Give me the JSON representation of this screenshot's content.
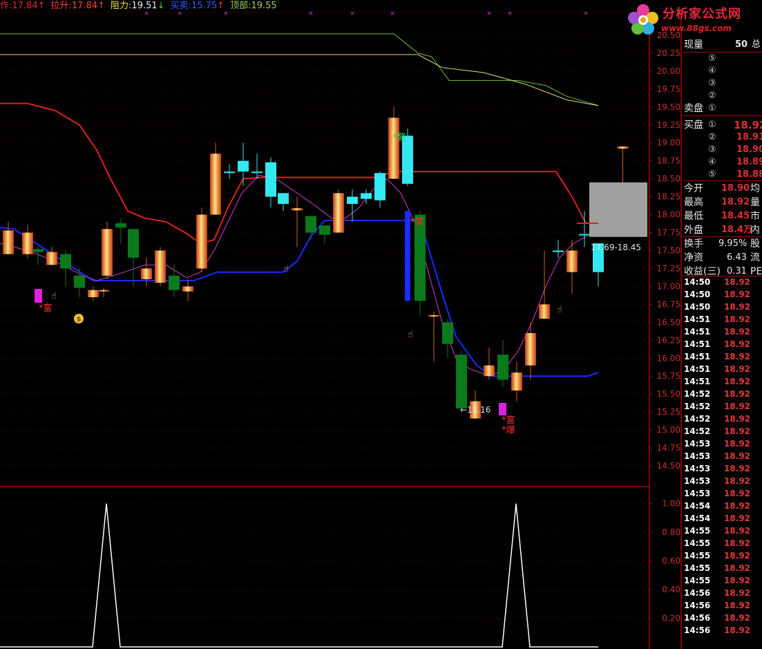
{
  "indicator_bar": [
    {
      "label": "作: ",
      "value": "17.84",
      "arrow": "↑",
      "label_color": "#e03030",
      "value_color": "#e03030",
      "arrow_color": "#e03030"
    },
    {
      "label": "拉升: ",
      "value": "17.84",
      "arrow": "↑",
      "label_color": "#ff4040",
      "value_color": "#ff4040",
      "arrow_color": "#ff4040"
    },
    {
      "label": "阻力: ",
      "value": "19.51",
      "arrow": "↓",
      "label_color": "#f0e040",
      "value_color": "#f0f0f0",
      "arrow_color": "#40d040"
    },
    {
      "label": "买卖: ",
      "value": "15.75",
      "arrow": "↑",
      "label_color": "#3060ff",
      "value_color": "#3060ff",
      "arrow_color": "#ff3030"
    },
    {
      "label": "顶部: ",
      "value": "19.55",
      "arrow": "",
      "label_color": "#a0d060",
      "value_color": "#a0d060",
      "arrow_color": "#a0d060"
    }
  ],
  "logo": {
    "name": "分析家公式网",
    "url": "www.88gs.com"
  },
  "colors": {
    "background": "#000000",
    "grid": "#5a0000",
    "axis": "#b00000",
    "tick_text": "#c83030",
    "cyan": "#33e8f0",
    "green_candle": "#0a7a1a",
    "red_line": "#e02020",
    "blue_line": "#1a2cff",
    "magenta_line": "#d040d0",
    "yellow_line": "#e0e080",
    "green_line": "#70c040"
  },
  "chart_data": [
    {
      "type": "candlestick",
      "ylim": [
        14.25,
        20.75
      ],
      "ticks": [
        "20.50",
        "20.25",
        "20.00",
        "19.75",
        "19.50",
        "19.25",
        "19.00",
        "18.75",
        "18.50",
        "18.25",
        "18.00",
        "17.75",
        "17.50",
        "17.25",
        "17.00",
        "16.75",
        "16.50",
        "16.25",
        "16.00",
        "15.75",
        "15.50",
        "15.25",
        "15.00",
        "14.75",
        "14.50"
      ],
      "candles": [
        {
          "o": 17.78,
          "h": 17.9,
          "l": 17.6,
          "c": 17.45,
          "k": "up"
        },
        {
          "o": 17.75,
          "h": 17.85,
          "l": 17.4,
          "c": 17.45,
          "k": "up"
        },
        {
          "o": 17.48,
          "h": 17.55,
          "l": 17.3,
          "c": 17.52,
          "k": "dn"
        },
        {
          "o": 17.48,
          "h": 17.55,
          "l": 17.3,
          "c": 17.3,
          "k": "up"
        },
        {
          "o": 17.25,
          "h": 17.5,
          "l": 17.0,
          "c": 17.45,
          "k": "dn"
        },
        {
          "o": 17.15,
          "h": 17.25,
          "l": 16.85,
          "c": 16.98,
          "k": "dn"
        },
        {
          "o": 16.85,
          "h": 17.0,
          "l": 16.8,
          "c": 16.95,
          "k": "up"
        },
        {
          "o": 16.95,
          "h": 16.98,
          "l": 16.85,
          "c": 16.93,
          "k": "up"
        },
        {
          "o": 17.8,
          "h": 17.9,
          "l": 17.1,
          "c": 17.15,
          "k": "up"
        },
        {
          "o": 17.88,
          "h": 17.95,
          "l": 17.6,
          "c": 17.82,
          "k": "dn"
        },
        {
          "o": 17.4,
          "h": 17.5,
          "l": 17.0,
          "c": 17.8,
          "k": "dn"
        },
        {
          "o": 17.25,
          "h": 17.4,
          "l": 17.0,
          "c": 17.1,
          "k": "up"
        },
        {
          "o": 17.5,
          "h": 17.55,
          "l": 17.0,
          "c": 17.05,
          "k": "up"
        },
        {
          "o": 17.15,
          "h": 17.3,
          "l": 16.85,
          "c": 16.95,
          "k": "dn"
        },
        {
          "o": 16.93,
          "h": 17.1,
          "l": 16.8,
          "c": 17.0,
          "k": "up"
        },
        {
          "o": 18.0,
          "h": 18.1,
          "l": 17.2,
          "c": 17.25,
          "k": "up"
        },
        {
          "o": 18.85,
          "h": 19.0,
          "l": 18.0,
          "c": 18.0,
          "k": "up"
        },
        {
          "o": 18.6,
          "h": 18.7,
          "l": 18.5,
          "c": 18.58,
          "k": "cyan"
        },
        {
          "o": 18.75,
          "h": 19.0,
          "l": 18.4,
          "c": 18.6,
          "k": "cyan"
        },
        {
          "o": 18.6,
          "h": 18.85,
          "l": 18.5,
          "c": 18.58,
          "k": "cyan"
        },
        {
          "o": 18.25,
          "h": 18.8,
          "l": 18.1,
          "c": 18.73,
          "k": "cyan"
        },
        {
          "o": 18.15,
          "h": 18.25,
          "l": 18.05,
          "c": 18.3,
          "k": "cyan"
        },
        {
          "o": 18.09,
          "h": 18.25,
          "l": 17.55,
          "c": 18.06,
          "k": "up"
        },
        {
          "o": 17.75,
          "h": 17.95,
          "l": 17.65,
          "c": 17.98,
          "k": "dn"
        },
        {
          "o": 17.72,
          "h": 17.8,
          "l": 17.6,
          "c": 17.85,
          "k": "dn"
        },
        {
          "o": 18.3,
          "h": 18.35,
          "l": 17.8,
          "c": 17.75,
          "k": "up"
        },
        {
          "o": 18.15,
          "h": 18.35,
          "l": 17.9,
          "c": 18.25,
          "k": "cyan"
        },
        {
          "o": 18.22,
          "h": 18.35,
          "l": 18.15,
          "c": 18.3,
          "k": "cyan"
        },
        {
          "o": 18.2,
          "h": 18.6,
          "l": 18.1,
          "c": 18.58,
          "k": "cyan"
        },
        {
          "o": 19.35,
          "h": 19.5,
          "l": 18.5,
          "c": 18.5,
          "k": "up"
        },
        {
          "o": 19.1,
          "h": 19.2,
          "l": 18.4,
          "c": 18.43,
          "k": "cyan"
        },
        {
          "o": 18.0,
          "h": 18.05,
          "l": 16.6,
          "c": 16.8,
          "k": "dn"
        },
        {
          "o": 16.6,
          "h": 16.65,
          "l": 15.95,
          "c": 16.6,
          "k": "up"
        },
        {
          "o": 16.5,
          "h": 16.55,
          "l": 16.0,
          "c": 16.2,
          "k": "dn"
        },
        {
          "o": 16.05,
          "h": 16.1,
          "l": 15.3,
          "c": 15.3,
          "k": "dn"
        },
        {
          "o": 15.4,
          "h": 15.55,
          "l": 15.16,
          "c": 15.16,
          "k": "up"
        },
        {
          "o": 15.9,
          "h": 16.15,
          "l": 15.7,
          "c": 15.75,
          "k": "up"
        },
        {
          "o": 16.05,
          "h": 16.25,
          "l": 15.6,
          "c": 15.7,
          "k": "dn"
        },
        {
          "o": 15.8,
          "h": 15.95,
          "l": 15.4,
          "c": 15.55,
          "k": "up"
        },
        {
          "o": 16.35,
          "h": 16.5,
          "l": 15.7,
          "c": 15.9,
          "k": "up"
        },
        {
          "o": 16.75,
          "h": 17.5,
          "l": 16.55,
          "c": 16.55,
          "k": "up"
        },
        {
          "o": 17.5,
          "h": 17.65,
          "l": 17.4,
          "c": 17.48,
          "k": "cyan"
        },
        {
          "o": 17.5,
          "h": 17.65,
          "l": 16.9,
          "c": 17.2,
          "k": "up"
        },
        {
          "o": 17.73,
          "h": 18.05,
          "l": 17.55,
          "c": 17.73,
          "k": "cyan"
        },
        {
          "o": 17.2,
          "h": 17.55,
          "l": 17.0,
          "c": 17.6,
          "k": "cyan"
        },
        {
          "o": 18.95,
          "h": 18.95,
          "l": 18.4,
          "c": 18.92,
          "k": "up"
        }
      ],
      "lines": {
        "red": [
          18.43,
          18.43,
          18.3,
          18.2,
          18.1,
          18.0,
          17.95,
          17.85,
          17.6,
          17.35,
          17.15,
          17.05,
          17.0,
          16.95,
          16.9,
          16.9,
          16.85,
          16.82,
          16.8,
          16.75,
          16.72,
          16.68,
          16.65,
          16.62,
          16.6,
          16.58,
          16.55,
          16.53,
          16.55,
          16.58,
          16.6,
          16.65,
          16.7,
          16.8,
          16.95,
          17.1,
          17.2,
          17.3,
          17.4,
          17.45,
          17.55,
          17.6,
          17.6,
          17.62,
          17.65,
          17.68
        ],
        "blue": [
          17.82,
          17.8,
          17.7,
          17.55,
          17.35,
          17.2,
          17.1,
          17.08,
          17.08,
          17.08,
          17.08,
          17.08,
          17.08,
          17.08,
          17.08,
          17.08,
          17.15,
          17.2,
          17.2,
          17.2,
          17.2,
          17.2,
          17.2,
          17.3,
          17.55,
          17.8,
          17.92,
          17.92,
          17.92,
          17.92,
          17.92,
          17.92,
          17.92,
          17.92,
          17.8,
          17.2,
          16.5,
          16.0,
          15.8,
          15.75,
          15.75,
          15.75,
          15.75,
          15.75,
          15.75,
          15.8
        ],
        "magenta": [
          17.6,
          17.55,
          17.45,
          17.35,
          17.25,
          17.15,
          17.05,
          17.05,
          17.1,
          17.2,
          17.3,
          17.35,
          17.32,
          17.2,
          17.15,
          17.3,
          17.8,
          18.4,
          18.55,
          18.5,
          18.4,
          18.3,
          18.15,
          18.05,
          17.95,
          17.9,
          17.95,
          18.05,
          18.15,
          18.3,
          18.55,
          18.45,
          17.95,
          17.2,
          16.5,
          16.0,
          15.85,
          15.75,
          15.75,
          15.8,
          16.0,
          16.3,
          16.7,
          17.1,
          17.45,
          17.6
        ],
        "yellow_start": 20.23,
        "green_start": 20.52
      },
      "labels": [
        {
          "text": "*警",
          "color": "#30d060"
        },
        {
          "text": "*禁",
          "color": "#ff3030"
        },
        {
          "text": "*富",
          "color": "#ff3030"
        },
        {
          "text": "*爆",
          "color": "#ff3030"
        },
        {
          "text": "←15.16",
          "color": "#e0e0e0"
        },
        {
          "text": "17.69-18.45",
          "color": "#e0e0e0"
        }
      ]
    },
    {
      "type": "line",
      "ylim": [
        0,
        1.1
      ],
      "ticks": [
        "1.00",
        "0.80",
        "0.60",
        "0.40",
        "0.20"
      ],
      "values": [
        0,
        0,
        0,
        0,
        0,
        0,
        0,
        1,
        0,
        0,
        0,
        0,
        0,
        0,
        0,
        0,
        0,
        0,
        0,
        0,
        0,
        0,
        0,
        0,
        0,
        0,
        0,
        0,
        0,
        0,
        0,
        0,
        0,
        0,
        0,
        0,
        0,
        1,
        0,
        0,
        0,
        0,
        0,
        0,
        0,
        0
      ]
    }
  ],
  "panel": {
    "xianliang": {
      "label": "现量",
      "value": "50",
      "extra": "总"
    },
    "sell_levels": [
      "⑤",
      "④",
      "③",
      "②",
      "①"
    ],
    "sell_label": "卖盘",
    "buy_label": "买盘",
    "buy_levels": [
      {
        "n": "①",
        "price": "18.92"
      },
      {
        "n": "②",
        "price": "18.91"
      },
      {
        "n": "③",
        "price": "18.90"
      },
      {
        "n": "④",
        "price": "18.89"
      },
      {
        "n": "⑤",
        "price": "18.88"
      }
    ],
    "stats": [
      {
        "label": "今开",
        "value": "18.90",
        "extra": "均"
      },
      {
        "label": "最高",
        "value": "18.92",
        "extra": "量"
      },
      {
        "label": "最低",
        "value": "18.45",
        "extra": "市"
      },
      {
        "label": "外盘",
        "value": "18.4万",
        "extra": "内"
      }
    ],
    "stats2": [
      {
        "label": "换手",
        "value": "9.95%",
        "extra": "股"
      },
      {
        "label": "净资",
        "value": "6.43",
        "extra": "流"
      },
      {
        "label": "收益(三)",
        "value": "0.31",
        "extra": "PE"
      }
    ],
    "ticks": [
      {
        "time": "14:50",
        "price": "18.92"
      },
      {
        "time": "14:50",
        "price": "18.92"
      },
      {
        "time": "14:50",
        "price": "18.92"
      },
      {
        "time": "14:51",
        "price": "18.92"
      },
      {
        "time": "14:51",
        "price": "18.92"
      },
      {
        "time": "14:51",
        "price": "18.92"
      },
      {
        "time": "14:51",
        "price": "18.92"
      },
      {
        "time": "14:51",
        "price": "18.92"
      },
      {
        "time": "14:51",
        "price": "18.92"
      },
      {
        "time": "14:52",
        "price": "18.92"
      },
      {
        "time": "14:52",
        "price": "18.92"
      },
      {
        "time": "14:52",
        "price": "18.92"
      },
      {
        "time": "14:52",
        "price": "18.92"
      },
      {
        "time": "14:53",
        "price": "18.92"
      },
      {
        "time": "14:53",
        "price": "18.92"
      },
      {
        "time": "14:53",
        "price": "18.92"
      },
      {
        "time": "14:53",
        "price": "18.92"
      },
      {
        "time": "14:53",
        "price": "18.92"
      },
      {
        "time": "14:54",
        "price": "18.92"
      },
      {
        "time": "14:54",
        "price": "18.92"
      },
      {
        "time": "14:55",
        "price": "18.92"
      },
      {
        "time": "14:55",
        "price": "18.92"
      },
      {
        "time": "14:55",
        "price": "18.92"
      },
      {
        "time": "14:55",
        "price": "18.92"
      },
      {
        "time": "14:55",
        "price": "18.92"
      },
      {
        "time": "14:56",
        "price": "18.92"
      },
      {
        "time": "14:56",
        "price": "18.92"
      },
      {
        "time": "14:56",
        "price": "18.92"
      },
      {
        "time": "14:56",
        "price": "18.92"
      }
    ]
  }
}
